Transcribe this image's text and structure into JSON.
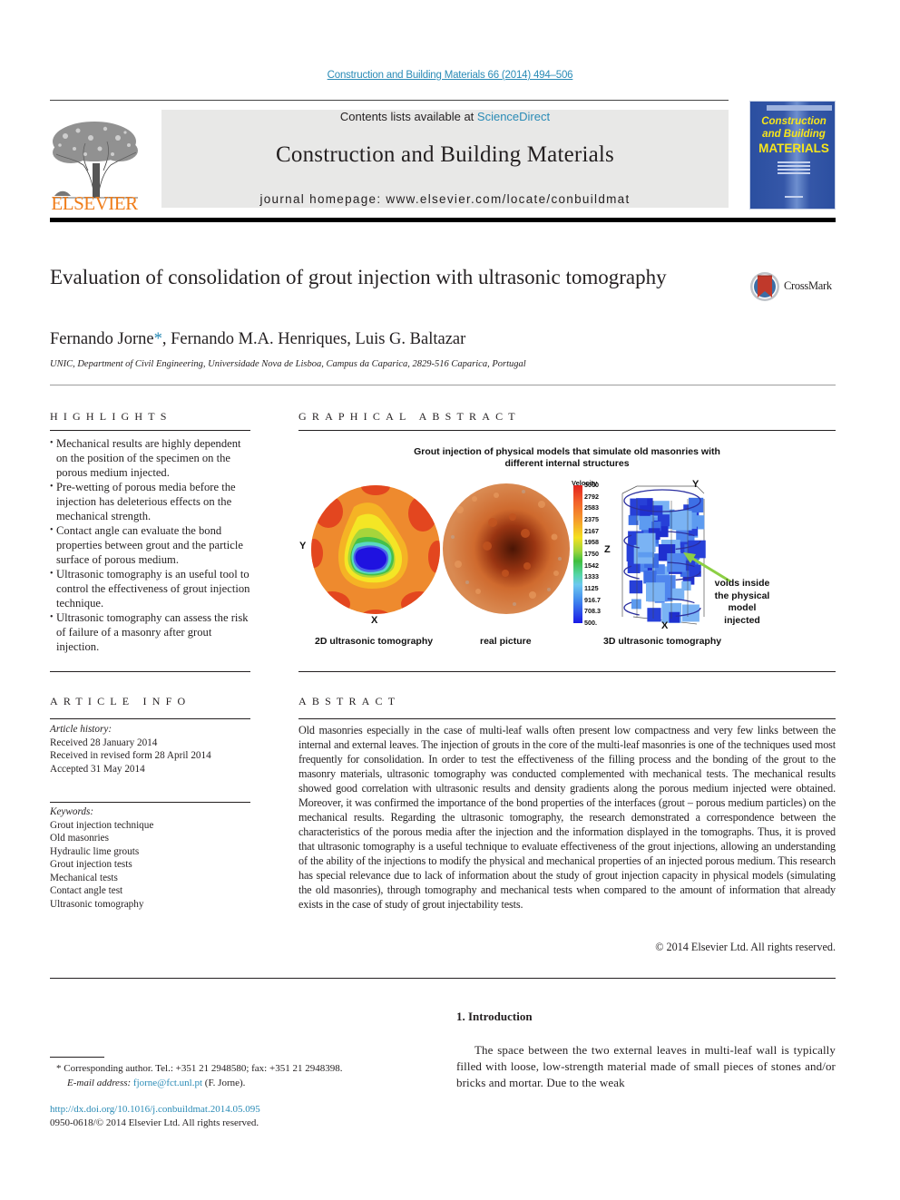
{
  "running_header": "Construction and Building Materials 66 (2014) 494–506",
  "masthead": {
    "publisher_logo": "ELSEVIER",
    "contents_prefix": "Contents lists available at ",
    "contents_link": "ScienceDirect",
    "journal_title": "Construction and Building Materials",
    "homepage_label": "journal homepage: www.elsevier.com/locate/conbuildmat",
    "cover": {
      "line1": "Construction",
      "line2": "and Building",
      "line3": "MATERIALS",
      "colors": {
        "background": "#2b4fa0",
        "title": "#f6e51b"
      }
    }
  },
  "article": {
    "title": "Evaluation of consolidation of grout injection with ultrasonic tomography",
    "crossmark_label": "CrossMark",
    "authors": [
      {
        "name": "Fernando Jorne",
        "corresponding_marker": "*"
      },
      {
        "name": "Fernando M.A. Henriques"
      },
      {
        "name": "Luis G. Baltazar"
      }
    ],
    "author_separator": ", ",
    "affiliation": "UNIC, Department of Civil Engineering, Universidade Nova de Lisboa, Campus da Caparica, 2829-516 Caparica, Portugal"
  },
  "highlights": {
    "heading": "HIGHLIGHTS",
    "items": [
      "Mechanical results are highly dependent on the position of the specimen on the porous medium injected.",
      "Pre-wetting of porous media before the injection has deleterious effects on the mechanical strength.",
      "Contact angle can evaluate the bond properties between grout and the particle surface of porous medium.",
      "Ultrasonic tomography is an useful tool to control the effectiveness of grout injection technique.",
      "Ultrasonic tomography can assess the risk of failure of a masonry after grout injection."
    ]
  },
  "graphical_abstract": {
    "heading": "GRAPHICAL ABSTRACT",
    "figure_title_line1": "Grout injection of physical models that simulate old masonries with",
    "figure_title_line2": "different internal structures",
    "panels": [
      {
        "caption": "2D ultrasonic tomography",
        "axis_x": "X",
        "axis_y": "Y"
      },
      {
        "caption": "real picture"
      },
      {
        "caption": "3D ultrasonic tomography",
        "axis_x": "X",
        "axis_y": "Y",
        "axis_z": "Z"
      }
    ],
    "velocity_scale": {
      "label": "Velocity",
      "ticks": [
        "3000",
        "2792",
        "2583",
        "2375",
        "2167",
        "1958",
        "1750",
        "1542",
        "1333",
        "1125",
        "916.7",
        "708.3",
        "500."
      ]
    },
    "annotation": [
      "voids inside",
      "the physical",
      "model",
      "injected"
    ]
  },
  "article_info": {
    "heading": "ARTICLE INFO",
    "history_label": "Article history:",
    "history": [
      "Received 28 January 2014",
      "Received in revised form 28 April 2014",
      "Accepted 31 May 2014"
    ],
    "keywords_label": "Keywords:",
    "keywords": [
      "Grout injection technique",
      "Old masonries",
      "Hydraulic lime grouts",
      "Grout injection tests",
      "Mechanical tests",
      "Contact angle test",
      "Ultrasonic tomography"
    ]
  },
  "abstract": {
    "heading": "ABSTRACT",
    "text": "Old masonries especially in the case of multi-leaf walls often present low compactness and very few links between the internal and external leaves. The injection of grouts in the core of the multi-leaf masonries is one of the techniques used most frequently for consolidation. In order to test the effectiveness of the fill­ing process and the bonding of the grout to the masonry materials, ultrasonic tomography was conducted complemented with mechanical tests. The mechanical results showed good correlation with ultrasonic results and density gradients along the porous medium injected were obtained. Moreover, it was con­firmed the importance of the bond properties of the interfaces (grout – porous medium particles) on the mechanical results. Regarding the ultrasonic tomography, the research demonstrated a correspon­dence between the characteristics of the porous media after the injection and the information displayed in the tomographs. Thus, it is proved that ultrasonic tomography is a useful technique to evaluate effec­tiveness of the grout injections, allowing an understanding of the ability of the injections to modify the physical and mechanical properties of an injected porous medium. This research has special relevance due to lack of information about the study of grout injection capacity in physical models (simulating the old masonries), through tomography and mechanical tests when compared to the amount of informa­tion that already exists in the case of study of grout injectability tests.",
    "copyright": "© 2014 Elsevier Ltd. All rights reserved."
  },
  "footnotes": {
    "corresponding": "*  Corresponding author. Tel.: +351 21 2948580; fax: +351 21 2948398.",
    "email_label": "E-mail address: ",
    "email": "fjorne@fct.unl.pt",
    "email_suffix": " (F. Jorne).",
    "doi": "http://dx.doi.org/10.1016/j.conbuildmat.2014.05.095",
    "issn_copyright": "0950-0618/© 2014 Elsevier Ltd. All rights reserved."
  },
  "introduction": {
    "heading": "1. Introduction",
    "text": "The space between the two external leaves in multi-leaf wall is typically filled with loose, low-strength material made of small pieces of stones and/or bricks and mortar. Due to the weak"
  },
  "colors": {
    "link": "#2a8bb6",
    "elsevier_orange": "#f07d1a",
    "masthead_gray": "#e8e8e7"
  }
}
